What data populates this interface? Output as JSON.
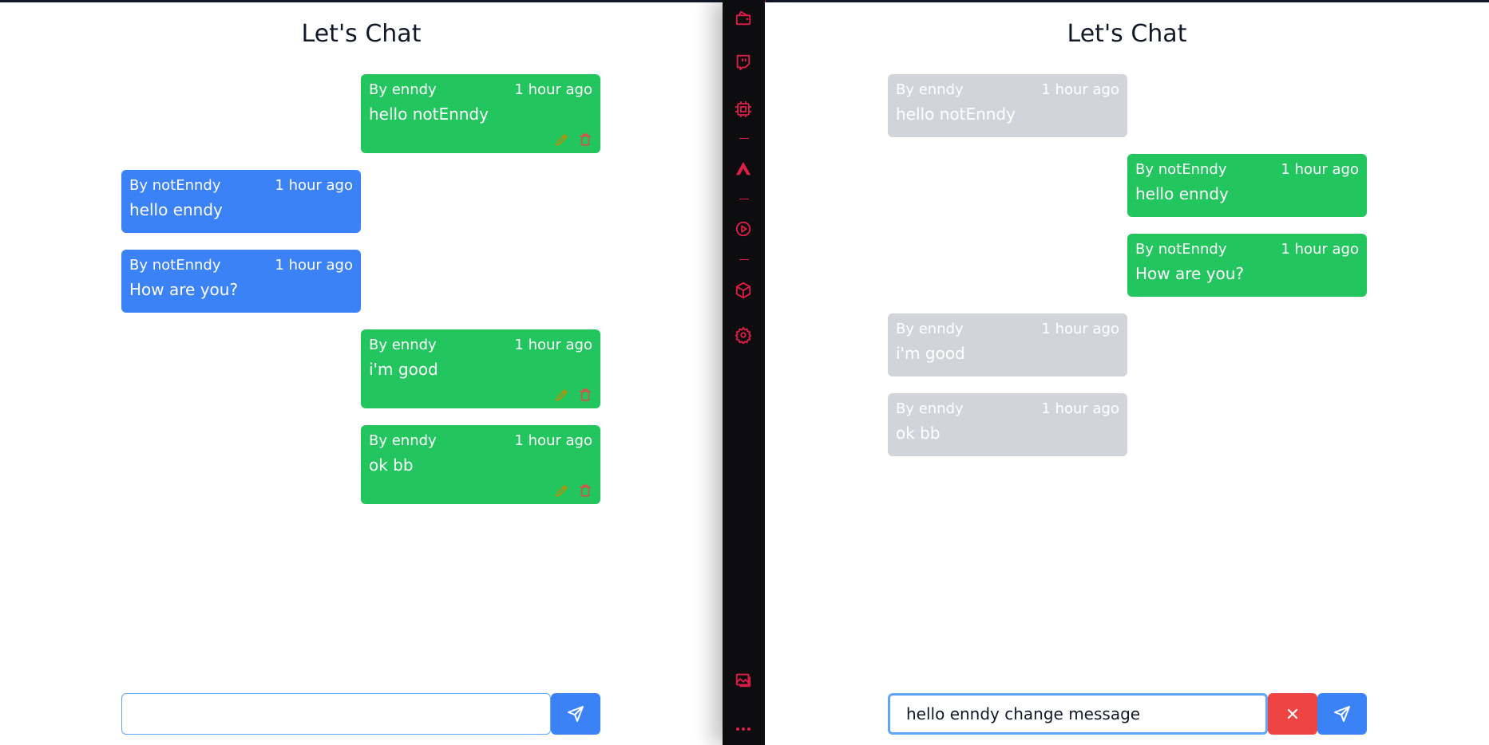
{
  "left": {
    "title": "Let's Chat",
    "messages": [
      {
        "by": "By enndy",
        "time": "1 hour ago",
        "text": "hello notEnndy"
      },
      {
        "by": "By notEnndy",
        "time": "1 hour ago",
        "text": "hello enndy"
      },
      {
        "by": "By notEnndy",
        "time": "1 hour ago",
        "text": "How are you?"
      },
      {
        "by": "By enndy",
        "time": "1 hour ago",
        "text": "i'm good"
      },
      {
        "by": "By enndy",
        "time": "1 hour ago",
        "text": "ok bb"
      }
    ],
    "input_value": ""
  },
  "right": {
    "title": "Let's Chat",
    "messages": [
      {
        "by": "By enndy",
        "time": "1 hour ago",
        "text": "hello notEnndy"
      },
      {
        "by": "By notEnndy",
        "time": "1 hour ago",
        "text": "hello enndy"
      },
      {
        "by": "By notEnndy",
        "time": "1 hour ago",
        "text": "How are you?"
      },
      {
        "by": "By enndy",
        "time": "1 hour ago",
        "text": "i'm good"
      },
      {
        "by": "By enndy",
        "time": "1 hour ago",
        "text": "ok bb"
      }
    ],
    "input_value": "hello enndy change message"
  },
  "sidebar": {
    "icons": [
      "wallet-icon",
      "twitch-icon",
      "chip-icon",
      "arrow-logo-icon",
      "play-circle-icon",
      "cube-icon",
      "gear-icon",
      "images-icon",
      "more-icon"
    ]
  },
  "colors": {
    "own_message": "#22c55e",
    "other_message": "#3b82f6",
    "faded_message": "#d1d5db",
    "send_button": "#3b82f6",
    "cancel_button": "#ef4444",
    "sidebar_accent": "#e11d48"
  }
}
